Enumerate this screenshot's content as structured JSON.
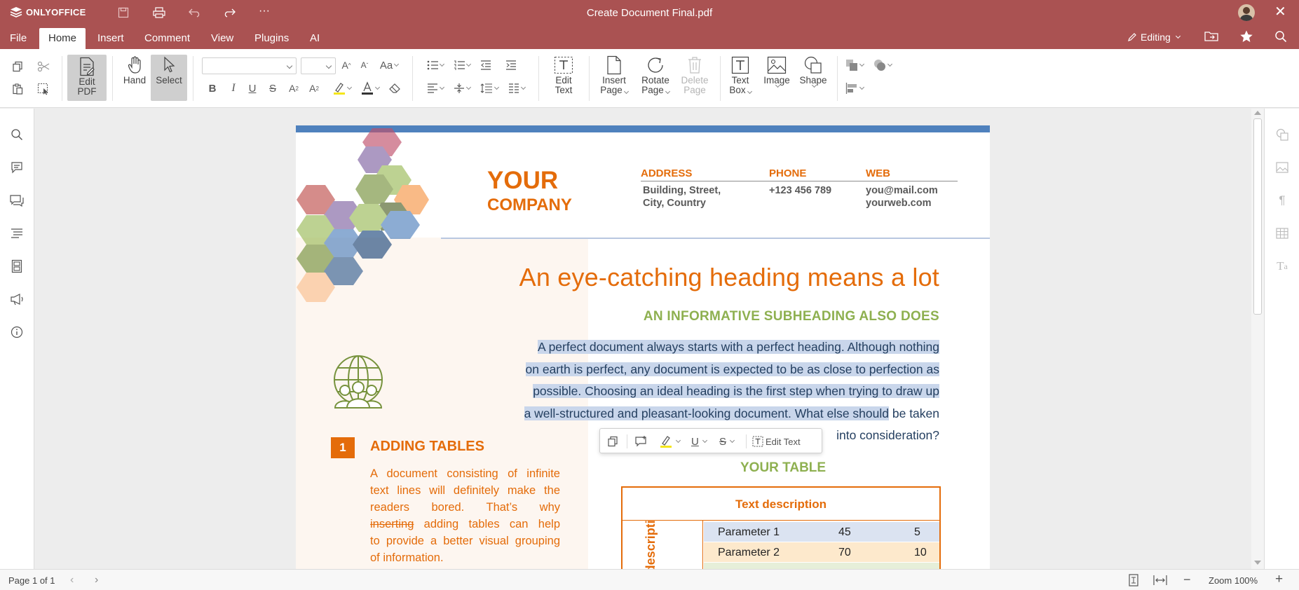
{
  "app": {
    "logo_text": "ONLYOFFICE",
    "document_title": "Create Document Final.pdf",
    "accent": "#aa5252"
  },
  "menu": {
    "tabs": [
      {
        "label": "File"
      },
      {
        "label": "Home"
      },
      {
        "label": "Insert"
      },
      {
        "label": "Comment"
      },
      {
        "label": "View"
      },
      {
        "label": "Plugins"
      },
      {
        "label": "AI"
      }
    ],
    "active_tab": "Home",
    "mode_label": "Editing"
  },
  "toolbar": {
    "edit_pdf": [
      "Edit",
      "PDF"
    ],
    "hand": "Hand",
    "select": "Select",
    "edit_text": [
      "Edit",
      "Text"
    ],
    "insert_page": [
      "Insert",
      "Page"
    ],
    "rotate_page": [
      "Rotate",
      "Page"
    ],
    "delete_page": [
      "Delete",
      "Page"
    ],
    "text_box": [
      "Text",
      "Box"
    ],
    "image": "Image",
    "shape": "Shape"
  },
  "document": {
    "company_line1": "YOUR",
    "company_line2": "COMPANY",
    "address_label": "ADDRESS",
    "address_line1": "Building, Street,",
    "address_line2": "City, Country",
    "phone_label": "PHONE",
    "phone_value": "+123 456 789",
    "web_label": "WEB",
    "web_line1": "you@mail.com",
    "web_line2": "yourweb.com",
    "heading": "An eye-catching heading means a lot",
    "subheading": "AN INFORMATIVE SUBHEADING ALSO DOES",
    "para_lines": [
      "A perfect document always starts with a perfect heading. Although nothing",
      "on earth is perfect, any document is expected to be as close to perfection as",
      "possible. Choosing an ideal heading is the first step when trying to draw up",
      "a well-structured and pleasant-looking document. What else should"
    ],
    "para_line4_tail": " be taken",
    "para_line5": "into consideration?",
    "section_number": "1",
    "section_title": "ADDING TABLES",
    "side_text_lines": [
      "A document consisting of infinite",
      "text lines will definitely make the",
      "readers bored. That’s why"
    ],
    "strike_word": "inserting",
    "side_text_line4_tail": " adding tables can help",
    "side_text_lines_end": [
      "to provide a better visual grouping",
      "of information."
    ],
    "table_title": "YOUR TABLE",
    "table_header": "Text description",
    "table_vertical_label": "Text description",
    "table_rows": [
      {
        "label": "Parameter 1",
        "v1": "45",
        "v2": "5"
      },
      {
        "label": "Parameter 2",
        "v1": "70",
        "v2": "10"
      }
    ]
  },
  "floating_toolbar": {
    "edit_text": "Edit Text"
  },
  "status": {
    "page_info": "Page 1 of 1",
    "zoom": "Zoom 100%"
  },
  "colors": {
    "orange": "#e46c0a",
    "green": "#8eb050",
    "highlight": "#c9d6eb",
    "rule_blue": "#4f81bd"
  }
}
